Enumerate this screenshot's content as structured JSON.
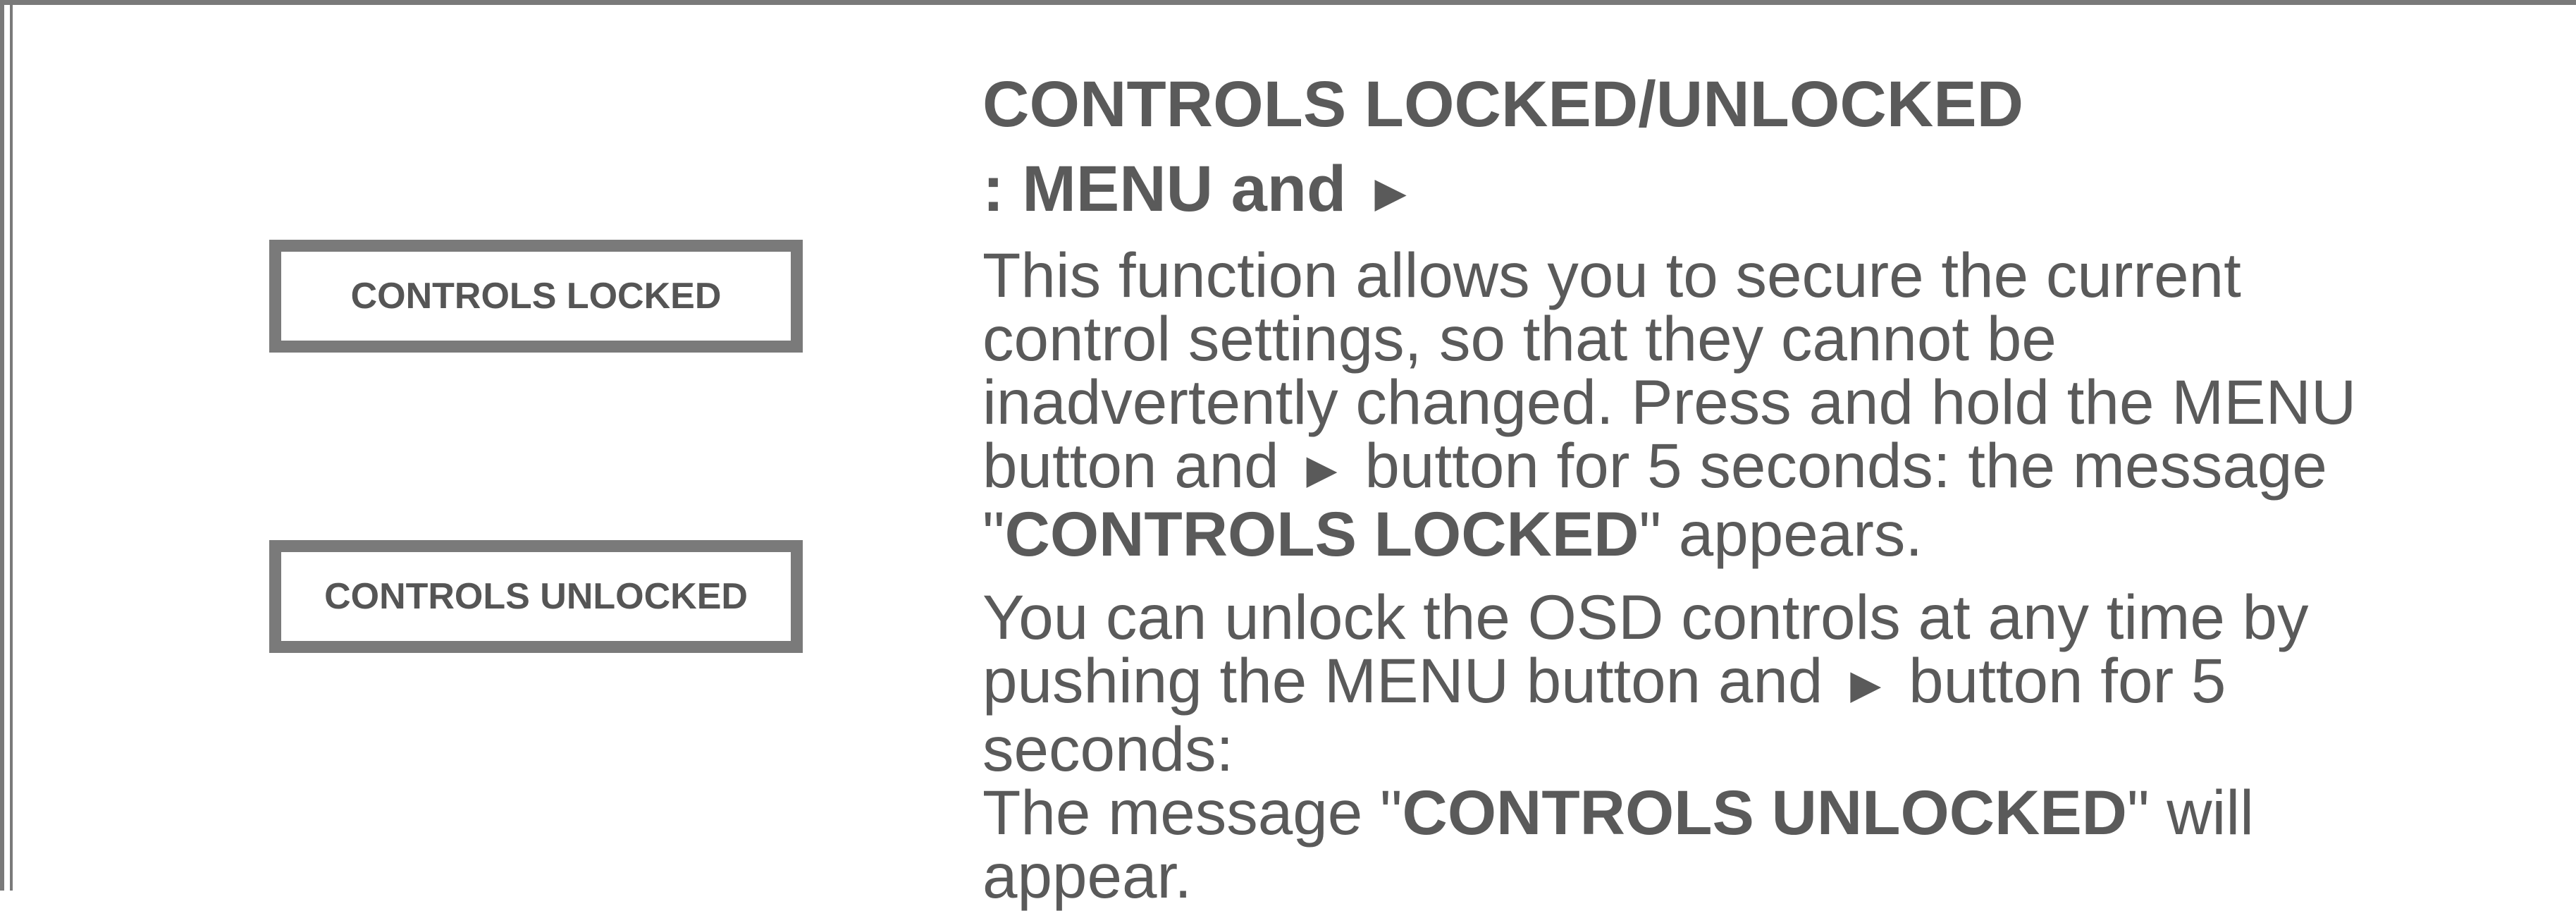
{
  "osd_messages": {
    "locked": "CONTROLS LOCKED",
    "unlocked": "CONTROLS UNLOCKED"
  },
  "section": {
    "title": "CONTROLS LOCKED/UNLOCKED",
    "subtitle_prefix": ": MENU and ",
    "arrow_symbol": "►"
  },
  "paragraph1": {
    "line1": "This function allows you to secure the current",
    "line2": "control settings, so that they cannot be",
    "line3": "inadvertently changed. Press and hold the MENU",
    "line4_a": "button and ",
    "line4_b": " button for 5 seconds: the message",
    "line5_quote_open": "\"",
    "line5_bold": "CONTROLS LOCKED",
    "line5_rest": "\" appears."
  },
  "paragraph2": {
    "line1": "You can unlock the OSD controls at any time by",
    "line2_a": "pushing the MENU button and ",
    "line2_b": " button for 5",
    "line3": "seconds:",
    "line4_a": "The message \"",
    "line4_bold": "CONTROLS UNLOCKED",
    "line4_b": "\" will",
    "line5": "appear."
  }
}
